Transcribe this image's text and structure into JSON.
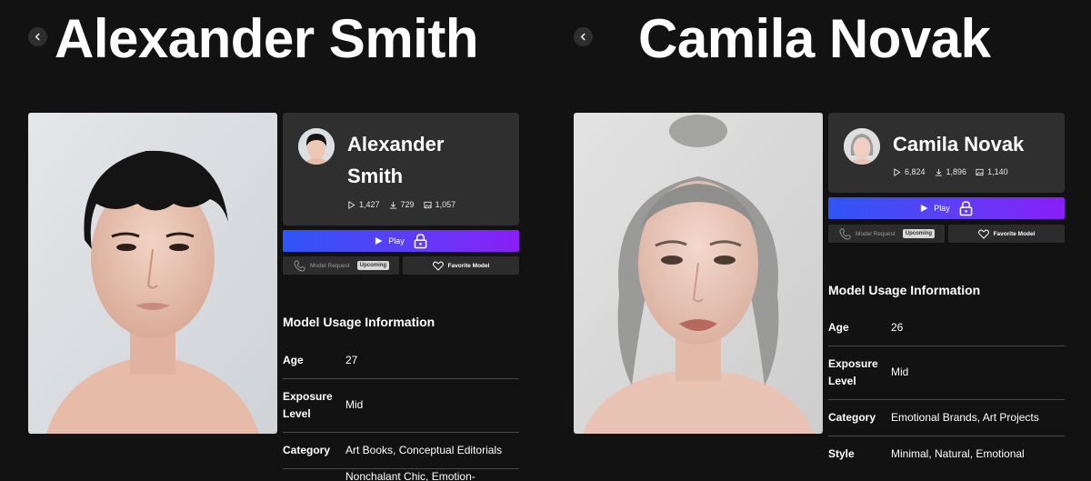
{
  "panels": [
    {
      "title": "Alexander Smith",
      "card_name_line1": "Alexander",
      "card_name_line2": "Smith",
      "stats": {
        "plays": "1,427",
        "downloads": "729",
        "images": "1,057"
      },
      "play_label": "Play",
      "request_label": "Model Request",
      "upcoming_label": "Upcoming",
      "favorite_label": "Favorite Model",
      "usage_title": "Model Usage Information",
      "info": [
        {
          "label": "Age",
          "value": "27"
        },
        {
          "label": "Exposure Level",
          "value": "Mid"
        },
        {
          "label": "Category",
          "value": "Art Books, Conceptual Editorials"
        },
        {
          "label": "",
          "value": "Nonchalant Chic, Emotion-"
        }
      ]
    },
    {
      "title": "Camila Novak",
      "card_name_line1": "Camila Novak",
      "stats": {
        "plays": "6,824",
        "downloads": "1,896",
        "images": "1,140"
      },
      "play_label": "Play",
      "request_label": "Model Request",
      "upcoming_label": "Upcoming",
      "favorite_label": "Favorite Model",
      "usage_title": "Model Usage Information",
      "info": [
        {
          "label": "Age",
          "value": "26"
        },
        {
          "label": "Exposure Level",
          "value": "Mid"
        },
        {
          "label": "Category",
          "value": "Emotional Brands, Art Projects"
        },
        {
          "label": "Style",
          "value": "Minimal, Natural, Emotional"
        }
      ]
    }
  ],
  "icons": {
    "back": "chevron-left-icon",
    "plays": "play-outline-icon",
    "downloads": "download-icon",
    "images": "image-icon",
    "play": "play-icon",
    "lock": "lock-icon",
    "phone": "phone-icon",
    "favorite": "heart-icon"
  },
  "colors": {
    "background": "#121212",
    "card": "#2f2f2f",
    "gradient_start": "#2f56f5",
    "gradient_end": "#8a1ef8",
    "divider": "#4a4a4a"
  }
}
